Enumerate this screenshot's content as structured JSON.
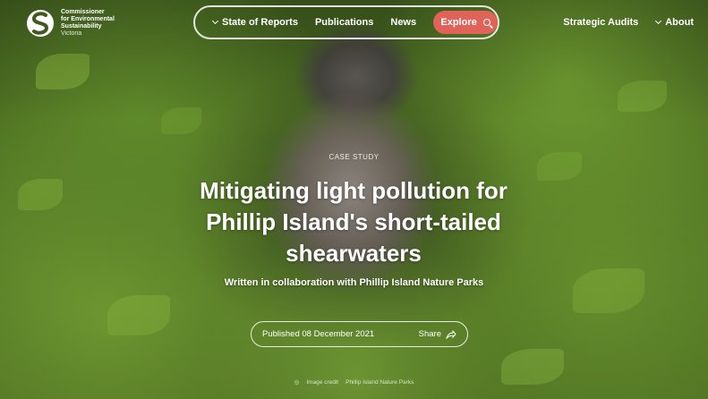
{
  "brand": {
    "line1": "Commissioner",
    "line2": "for Environmental",
    "line3": "Sustainability",
    "line4": "Victoria"
  },
  "nav": {
    "state_of_reports": "State of Reports",
    "publications": "Publications",
    "news": "News",
    "explore": "Explore",
    "strategic_audits": "Strategic Audits",
    "about": "About"
  },
  "article": {
    "kicker": "CASE STUDY",
    "title": "Mitigating light pollution for Phillip Island's short-tailed shearwaters",
    "subtitle": "Written in collaboration with Phillip Island Nature Parks",
    "published": "Published 08 December 2021",
    "share": "Share"
  },
  "credit": {
    "label": "Image credit",
    "source": "Phillip Island Nature Parks"
  },
  "colors": {
    "accent": "#e0635a",
    "text": "#ffffff"
  },
  "icons": [
    "logo-s-icon",
    "chevron-down-icon",
    "search-icon",
    "share-icon",
    "camera-icon"
  ]
}
